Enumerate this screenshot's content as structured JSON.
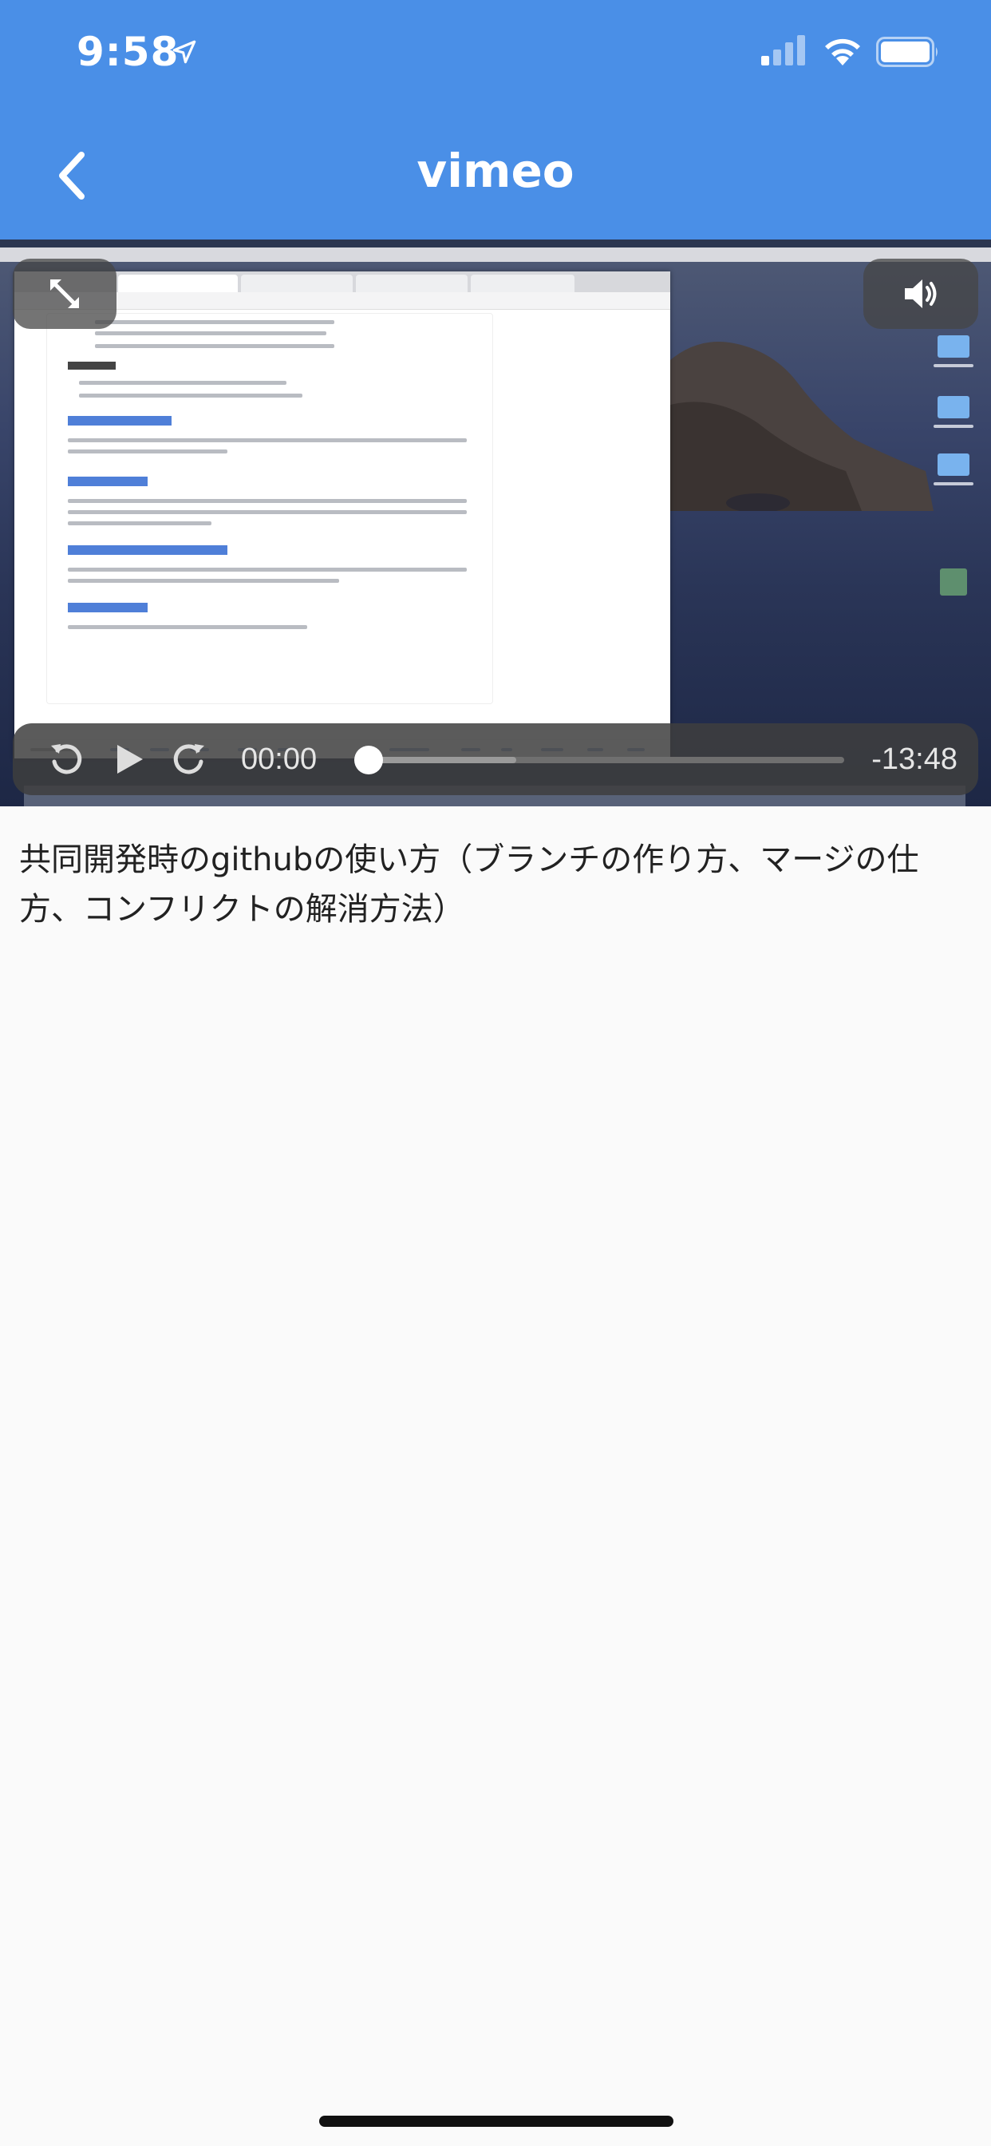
{
  "status_bar": {
    "time": "9:58",
    "icons": [
      "location-arrow-icon",
      "cellular-signal-icon",
      "wifi-icon",
      "battery-icon"
    ]
  },
  "nav": {
    "title": "vimeo",
    "back_icon": "chevron-left-icon"
  },
  "player": {
    "current_time": "00:00",
    "remaining_time": "-13:48",
    "progress": 0.0,
    "buffered": 0.33,
    "controls": [
      "expand-icon",
      "volume-icon",
      "rewind-icon",
      "play-icon",
      "forward-icon"
    ]
  },
  "video": {
    "description": "共同開発時のgithubの使い方（ブランチの作り方、マージの仕方、コンフリクトの解消方法）"
  },
  "colors": {
    "header": "#4a8fe7",
    "background": "#fafafa",
    "control_bg": "#3e3e3e"
  }
}
